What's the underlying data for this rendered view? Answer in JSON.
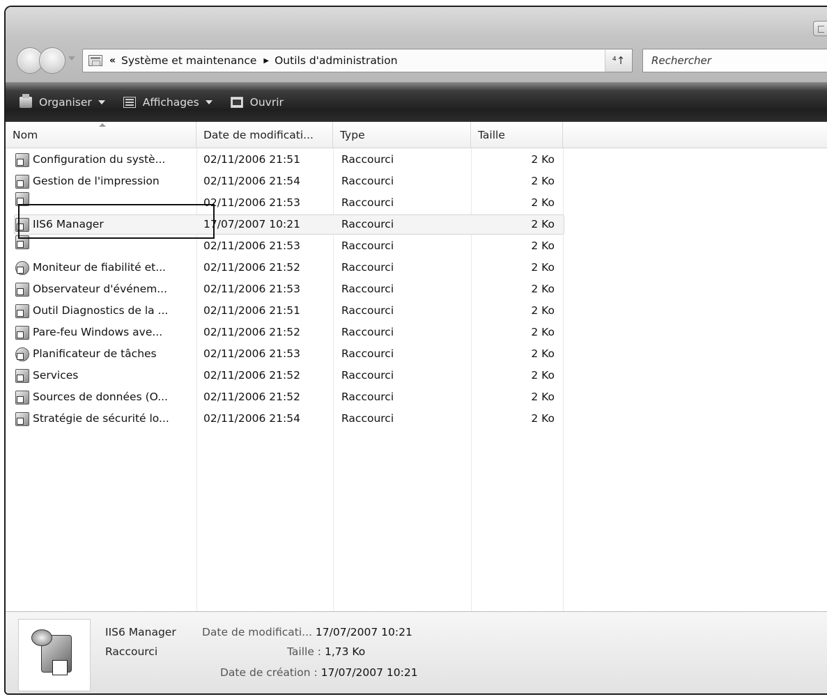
{
  "address": {
    "chevron": "«",
    "crumbs": [
      "Système et maintenance",
      "Outils d'administration"
    ]
  },
  "search": {
    "placeholder": "Rechercher"
  },
  "toolbar": {
    "organize": "Organiser",
    "views": "Affichages",
    "open": "Ouvrir"
  },
  "columns": {
    "name": "Nom",
    "date": "Date de modificati...",
    "type": "Type",
    "size": "Taille"
  },
  "files": [
    {
      "name": "Configuration du systè...",
      "date": "02/11/2006 21:51",
      "type": "Raccourci",
      "size": "2 Ko"
    },
    {
      "name": "Gestion de l'impression",
      "date": "02/11/2006 21:54",
      "type": "Raccourci",
      "size": "2 Ko"
    },
    {
      "name": "",
      "date": "02/11/2006 21:53",
      "type": "Raccourci",
      "size": "2 Ko"
    },
    {
      "name": "IIS6 Manager",
      "date": "17/07/2007 10:21",
      "type": "Raccourci",
      "size": "2 Ko"
    },
    {
      "name": "",
      "date": "02/11/2006 21:53",
      "type": "Raccourci",
      "size": "2 Ko"
    },
    {
      "name": "Moniteur de fiabilité et...",
      "date": "02/11/2006 21:52",
      "type": "Raccourci",
      "size": "2 Ko"
    },
    {
      "name": "Observateur d'événem...",
      "date": "02/11/2006 21:53",
      "type": "Raccourci",
      "size": "2 Ko"
    },
    {
      "name": "Outil Diagnostics de la ...",
      "date": "02/11/2006 21:51",
      "type": "Raccourci",
      "size": "2 Ko"
    },
    {
      "name": "Pare-feu Windows ave...",
      "date": "02/11/2006 21:52",
      "type": "Raccourci",
      "size": "2 Ko"
    },
    {
      "name": "Planificateur de tâches",
      "date": "02/11/2006 21:53",
      "type": "Raccourci",
      "size": "2 Ko"
    },
    {
      "name": "Services",
      "date": "02/11/2006 21:52",
      "type": "Raccourci",
      "size": "2 Ko"
    },
    {
      "name": "Sources de données (O...",
      "date": "02/11/2006 21:52",
      "type": "Raccourci",
      "size": "2 Ko"
    },
    {
      "name": "Stratégie de sécurité lo...",
      "date": "02/11/2006 21:54",
      "type": "Raccourci",
      "size": "2 Ko"
    }
  ],
  "details": {
    "name": "IIS6 Manager",
    "type": "Raccourci",
    "date_modified_label": "Date de modificati...",
    "date_modified": "17/07/2007 10:21",
    "size_label": "Taille :",
    "size": "1,73 Ko",
    "date_created_label": "Date de création :",
    "date_created": "17/07/2007 10:21"
  }
}
